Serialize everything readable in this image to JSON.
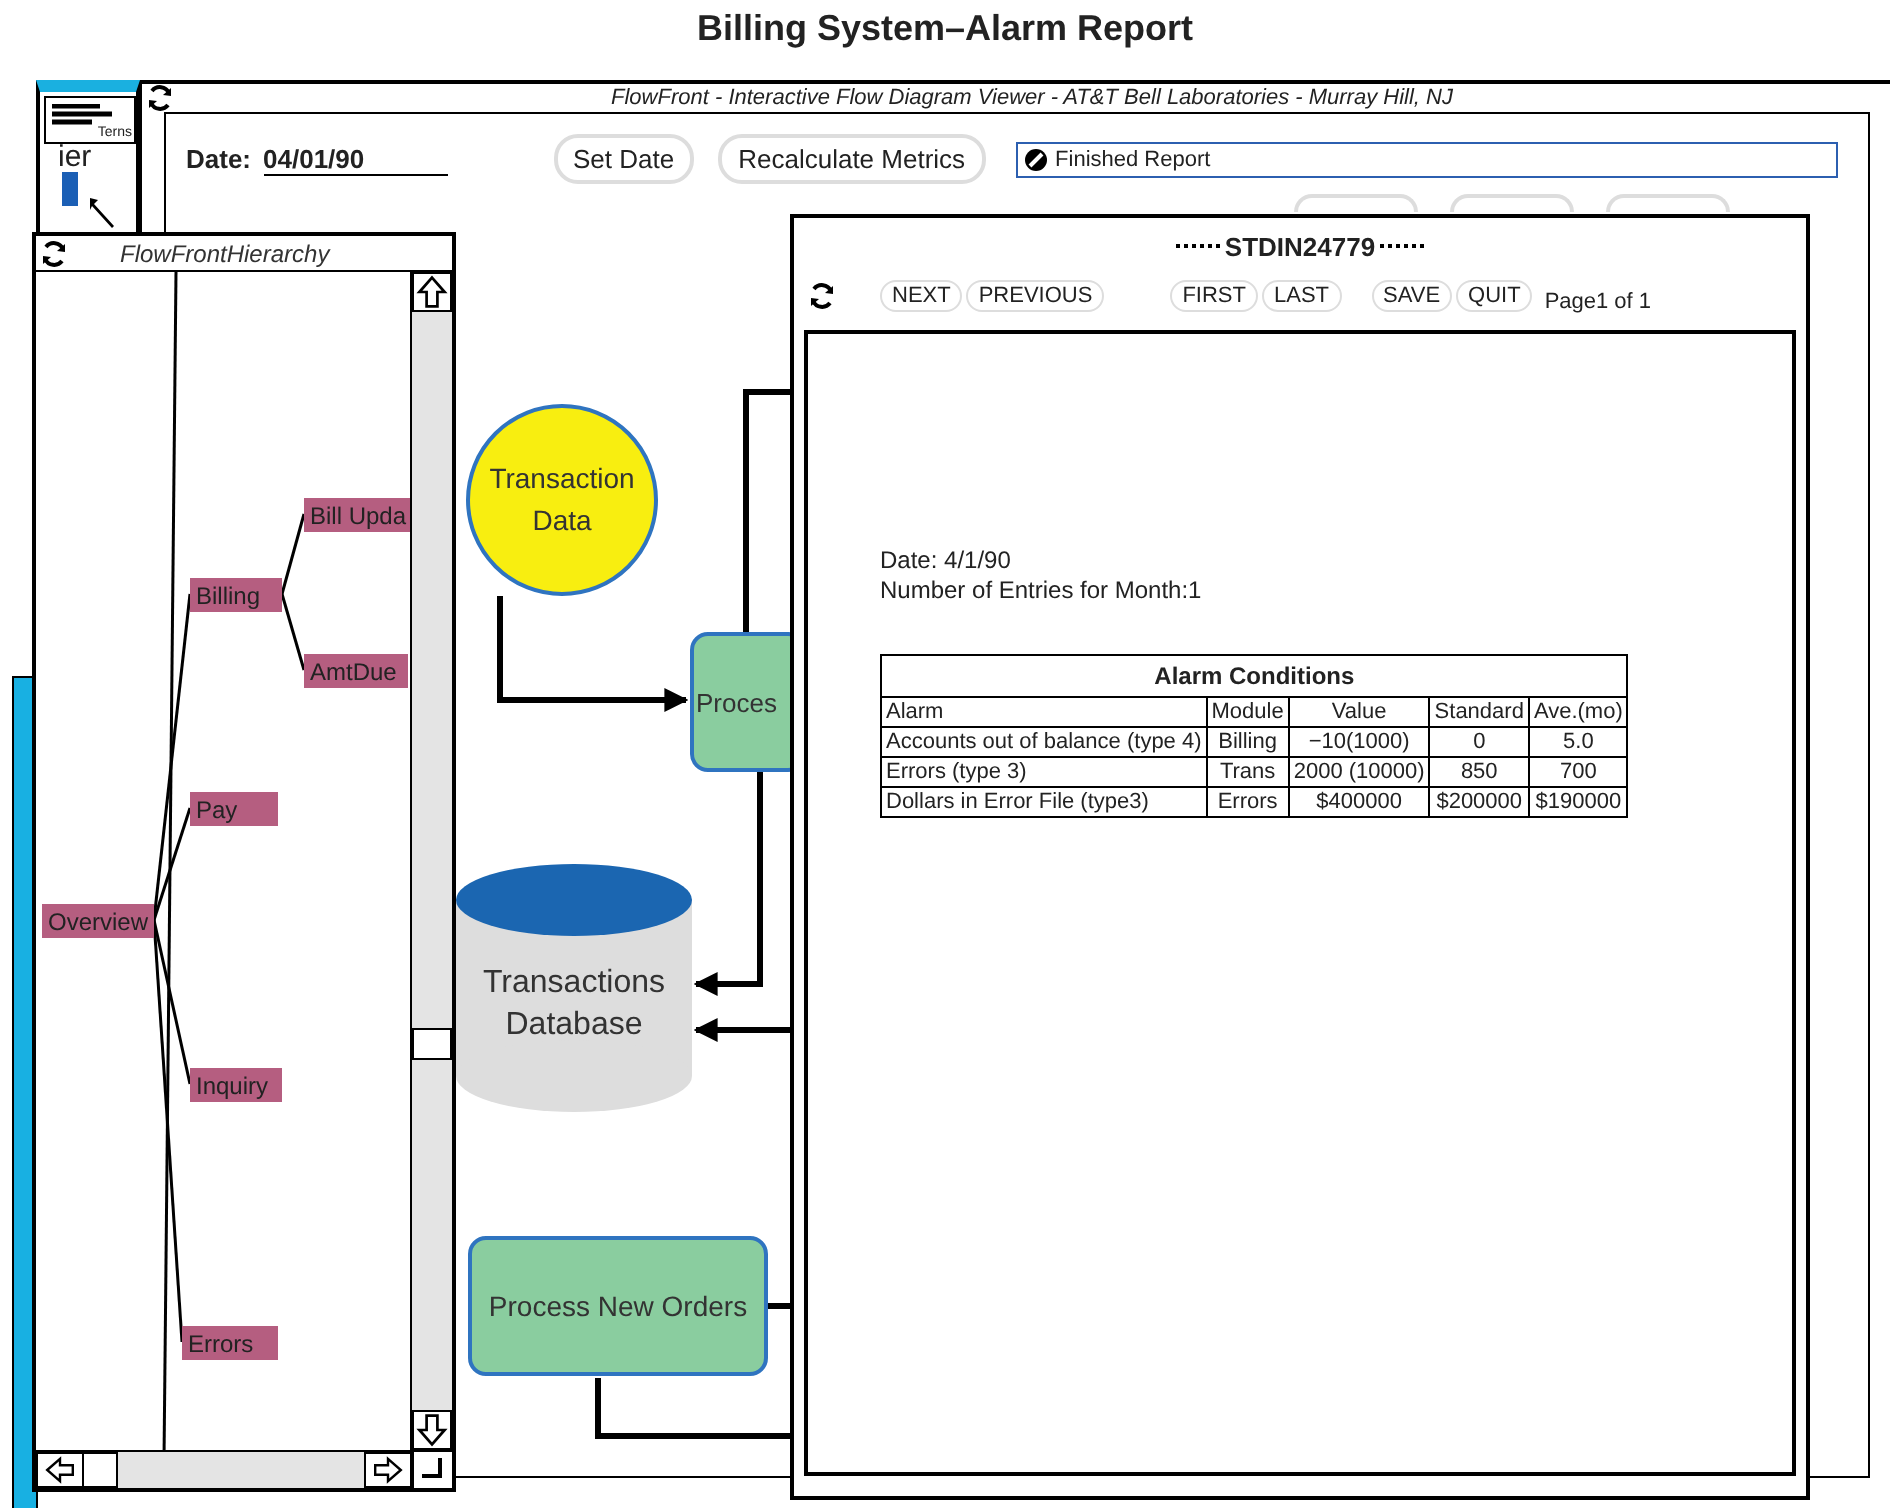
{
  "page_title": "Billing System–Alarm Report",
  "background_window": {
    "icon_label": "Terns",
    "title_fragment": "ier"
  },
  "main_window": {
    "title": "FlowFront - Interactive Flow Diagram Viewer - AT&T Bell Laboratories - Murray Hill, NJ",
    "date_label": "Date:",
    "date_value": "04/01/90",
    "buttons": [
      "Set Date",
      "Recalculate Metrics"
    ],
    "status": "Finished Report",
    "hidden_buttons": [
      {
        "kind": "button"
      },
      {
        "kind": "button"
      },
      {
        "kind": "button"
      }
    ]
  },
  "diagram": {
    "nodes": [
      {
        "kind": "data",
        "label": "Transaction Data"
      },
      {
        "kind": "process",
        "label": "Proces"
      },
      {
        "kind": "store",
        "label": "Transactions Database"
      },
      {
        "kind": "process",
        "label": "Process New Orders"
      }
    ]
  },
  "hierarchy_window": {
    "title": "FlowFrontHierarchy",
    "tree": [
      {
        "label": "Overview",
        "children": [
          {
            "label": "Billing",
            "children": [
              {
                "label": "Bill Upda"
              },
              {
                "label": "AmtDue"
              }
            ]
          },
          {
            "label": "Pay"
          },
          {
            "label": "Inquiry"
          },
          {
            "label": "Errors"
          }
        ]
      }
    ]
  },
  "report_window": {
    "title": "STDIN24779",
    "button_groups": [
      {
        "buttons": [
          "NEXT",
          "PREVIOUS"
        ]
      },
      {
        "buttons": [
          "FIRST",
          "LAST"
        ]
      },
      {
        "buttons": [
          "SAVE",
          "QUIT"
        ]
      }
    ],
    "page": "Page1 of 1",
    "date_line": "Date: 4/1/90",
    "entries_line": "Number of Entries for Month:1",
    "table": {
      "title": "Alarm Conditions",
      "columns": [
        "Alarm",
        "Module",
        "Value",
        "Standard",
        "Ave.(mo)"
      ],
      "rows": [
        [
          "Accounts out of balance (type 4)",
          "Billing",
          "−10(1000)",
          "0",
          "5.0"
        ],
        [
          "Errors (type 3)",
          "Trans",
          "2000 (10000)",
          "850",
          "700"
        ],
        [
          "Dollars in Error File (type3)",
          "Errors",
          "$400000",
          "$200000",
          "$190000"
        ]
      ]
    }
  }
}
